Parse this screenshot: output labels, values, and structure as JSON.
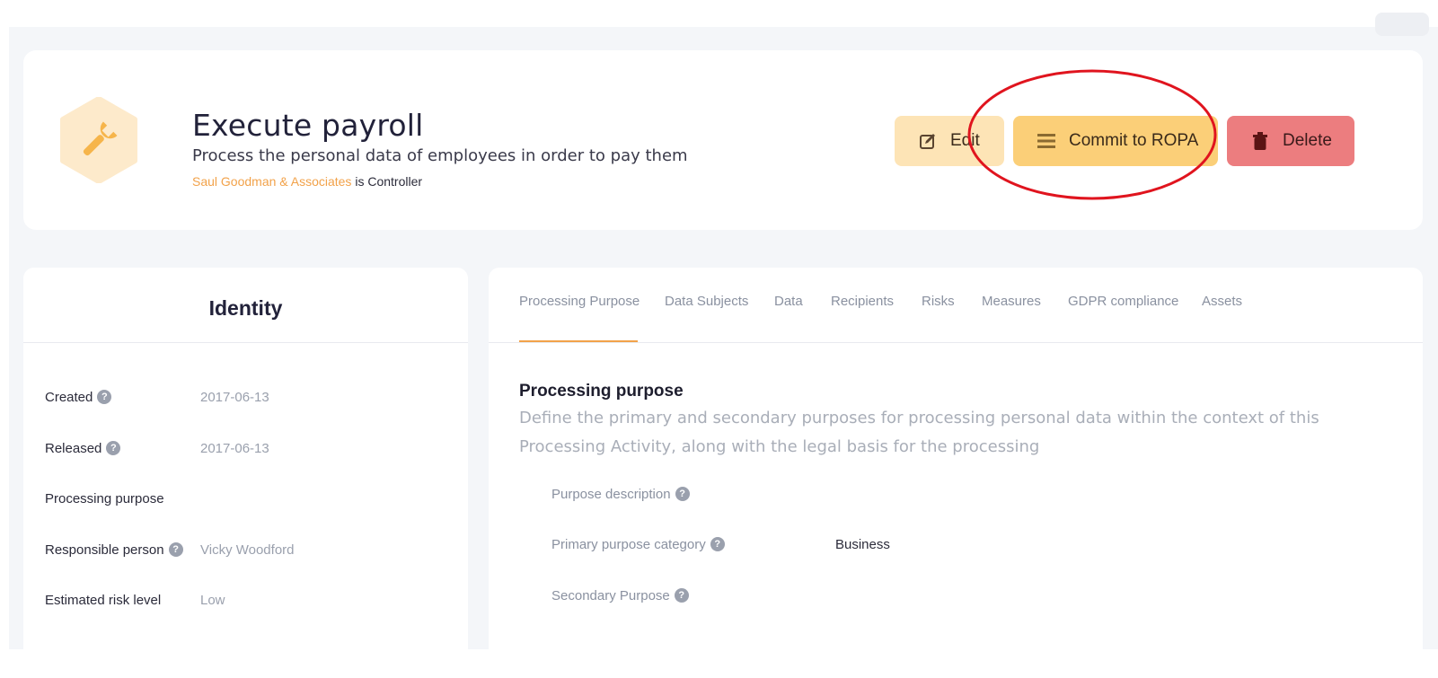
{
  "header": {
    "title": "Execute payroll",
    "subtitle": "Process the personal data of employees in order to pay them",
    "controller_name": "Saul Goodman & Associates",
    "controller_suffix": "is Controller",
    "icon": "wrench-icon",
    "buttons": {
      "edit": "Edit",
      "commit": "Commit to ROPA",
      "delete": "Delete"
    }
  },
  "identity": {
    "title": "Identity",
    "rows": [
      {
        "label": "Created",
        "value": "2017-06-13",
        "help": true
      },
      {
        "label": "Released",
        "value": "2017-06-13",
        "help": true
      },
      {
        "label": "Processing purpose",
        "value": "",
        "help": false
      },
      {
        "label": "Responsible person",
        "value": "Vicky Woodford",
        "help": true
      },
      {
        "label": "Estimated risk level",
        "value": "Low",
        "help": false
      }
    ]
  },
  "tabs": [
    "Processing Purpose",
    "Data Subjects",
    "Data",
    "Recipients",
    "Risks",
    "Measures",
    "GDPR compliance",
    "Assets"
  ],
  "section": {
    "title": "Processing purpose",
    "description": "Define the primary and secondary purposes for processing personal data within the context of this Processing Activity, along with the legal basis for the processing",
    "fields": [
      {
        "label": "Purpose description",
        "value": ""
      },
      {
        "label": "Primary purpose category",
        "value": "Business"
      },
      {
        "label": "Secondary Purpose",
        "value": ""
      }
    ]
  },
  "colors": {
    "accent": "#f2a24a",
    "edit_bg": "#fde4b6",
    "commit_bg": "#fbcf78",
    "delete_bg": "#ec7d7f",
    "annotation": "#e0141e"
  }
}
